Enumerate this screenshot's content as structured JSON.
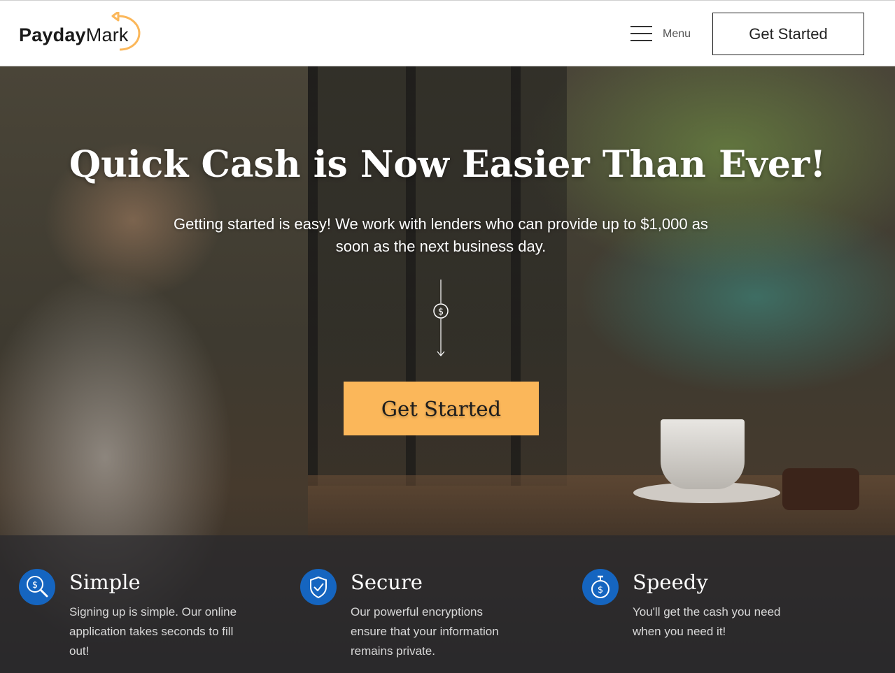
{
  "header": {
    "logo_bold": "Payday",
    "logo_light": "Mark",
    "menu_label": "Menu",
    "cta_label": "Get Started"
  },
  "hero": {
    "title": "Quick Cash is Now Easier Than Ever!",
    "subtitle": "Getting started is easy! We work with lenders who can provide up to $1,000 as soon as the next business day.",
    "cta_label": "Get Started"
  },
  "features": [
    {
      "icon": "dollar-search-icon",
      "title": "Simple",
      "description": "Signing up is simple. Our online application takes seconds to fill out!"
    },
    {
      "icon": "shield-check-icon",
      "title": "Secure",
      "description": "Our powerful encryptions ensure that your information remains private."
    },
    {
      "icon": "stopwatch-dollar-icon",
      "title": "Speedy",
      "description": "You'll get the cash you need when you need it!"
    }
  ],
  "colors": {
    "accent": "#fbb75a",
    "icon_blue": "#1565c0",
    "text_dark": "#1a1a1a"
  }
}
